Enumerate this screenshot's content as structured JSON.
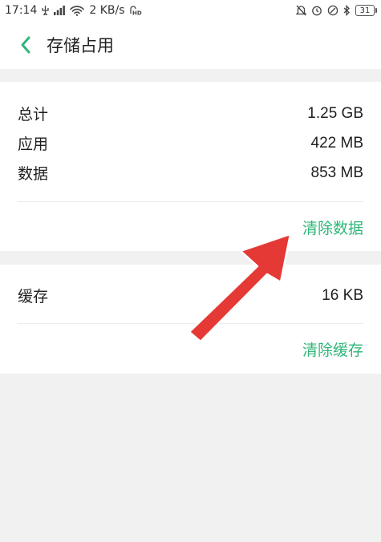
{
  "status_bar": {
    "time": "17:14",
    "network_speed": "2 KB/s",
    "battery": "31",
    "icons": [
      "usb-icon",
      "signal-icon",
      "wifi-icon",
      "hd-icon",
      "bell-off-icon",
      "alarm-icon",
      "dnd-icon",
      "bluetooth-icon",
      "battery-icon"
    ]
  },
  "header": {
    "title": "存储占用",
    "back_icon": "chevron-left-icon"
  },
  "storage": {
    "total_label": "总计",
    "total_value": "1.25 GB",
    "app_label": "应用",
    "app_value": "422 MB",
    "data_label": "数据",
    "data_value": "853 MB",
    "clear_data": "清除数据"
  },
  "cache": {
    "label": "缓存",
    "value": "16 KB",
    "clear_cache": "清除缓存"
  },
  "colors": {
    "accent": "#2fb67a",
    "arrow": "#e53935",
    "background": "#f1f1f1"
  }
}
